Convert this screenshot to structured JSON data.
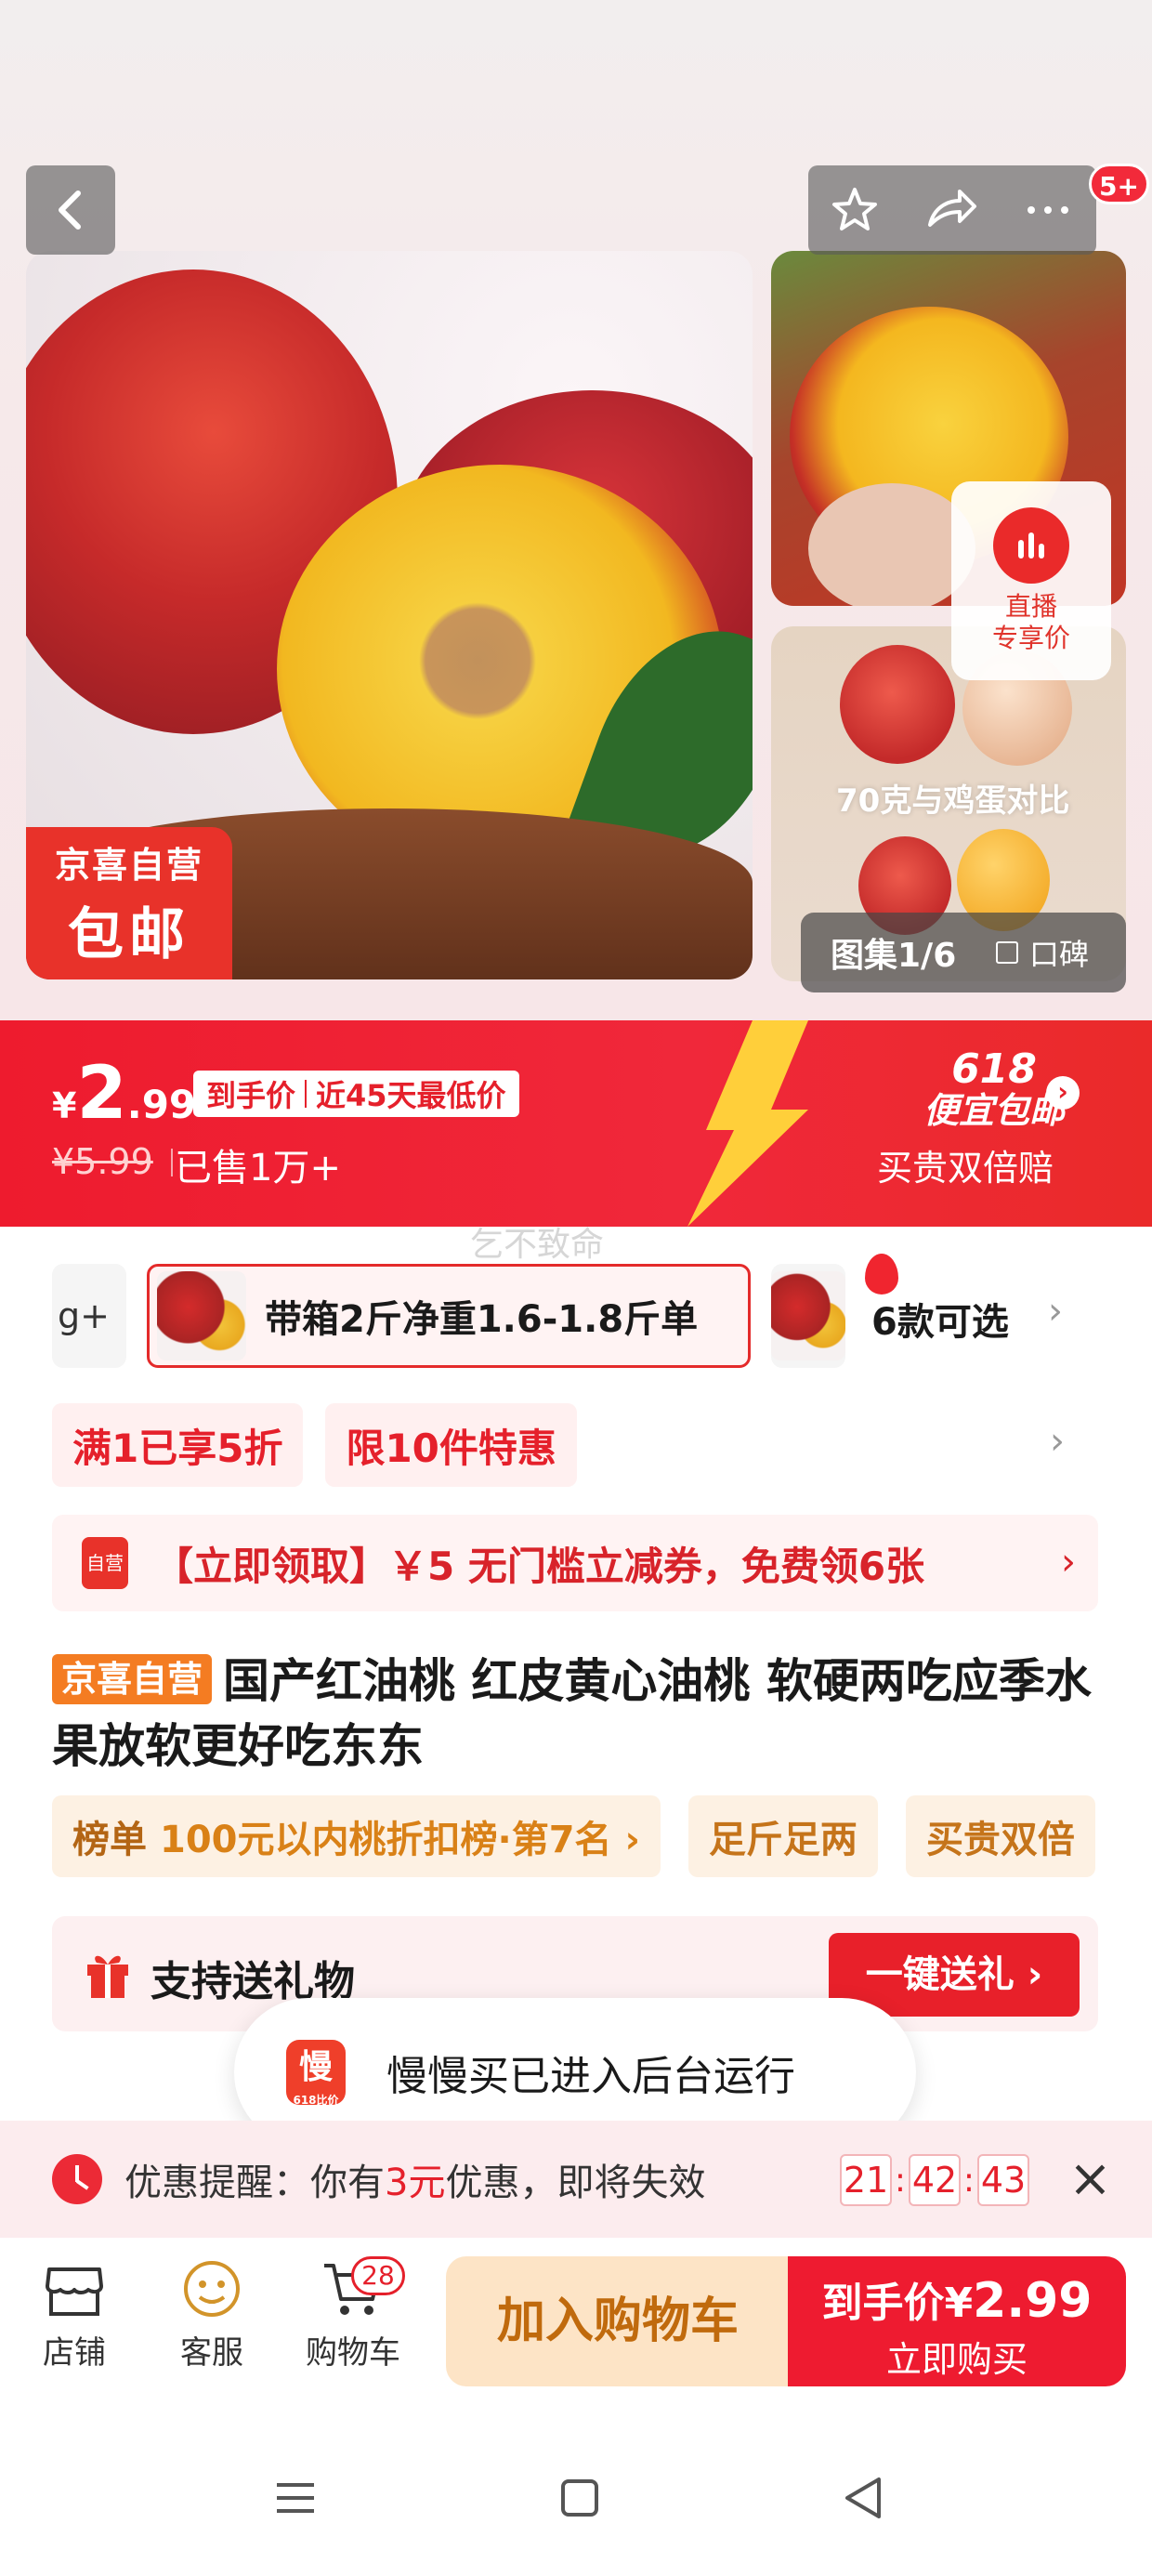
{
  "gallery": {
    "badge": "5+",
    "tag_line1": "京喜自营",
    "tag_line2": "包邮",
    "thumb2_caption": "70克与鸡蛋对比",
    "live_line1": "直播",
    "live_line2": "专享价",
    "counter": "图集1/6",
    "koubei": "口碑"
  },
  "price": {
    "currency": "¥",
    "integer": "2",
    "decimal": ".99",
    "tag_left": "到手价",
    "tag_right": "近45天最低价",
    "old_price": "¥5.99",
    "sold": "已售1万+",
    "promo_num": "618",
    "promo_text": "便宜包邮",
    "promo_sub": "买贵双倍赔"
  },
  "watermark": "乞不致命",
  "variants": {
    "left_text": "g+",
    "selected_label": "带箱2斤净重1.6-1.8斤单",
    "count": "6款可选"
  },
  "chips": [
    "满1已享5折",
    "限10件特惠"
  ],
  "coupon": {
    "icon_label": "自营",
    "text": "【立即领取】￥5 无门槛立减券，免费领6张"
  },
  "title": {
    "tag": "京喜自营",
    "text": "国产红油桃 红皮黄心油桃 软硬两吃应季水果放软更好吃东东"
  },
  "ranks": [
    {
      "key": "榜单",
      "value": "100元以内桃折扣榜·第7名 ›"
    },
    {
      "key": "",
      "value": "足斤足两"
    },
    {
      "key": "",
      "value": "买贵双倍"
    }
  ],
  "gift": {
    "text": "支持送礼物",
    "button": "一键送礼 ›"
  },
  "toast": {
    "icon_char": "慢",
    "icon_sub": "618比价",
    "text": "慢慢买已进入后台运行"
  },
  "reminder": {
    "prefix": "优惠提醒：你有",
    "amount": "3元",
    "suffix": "优惠，即将失效",
    "hh": "21",
    "mm": "42",
    "ss": "43"
  },
  "bottom_bar": {
    "store": "店铺",
    "service": "客服",
    "cart": "购物车",
    "cart_count": "28",
    "add_cart": "加入购物车",
    "buy_prefix": "到手价¥",
    "buy_price": "2.99",
    "buy_label": "立即购买"
  },
  "colors": {
    "accent_red": "#ee1b2e",
    "orange_tag": "#f47c22",
    "rank_gold": "#c5741a"
  }
}
